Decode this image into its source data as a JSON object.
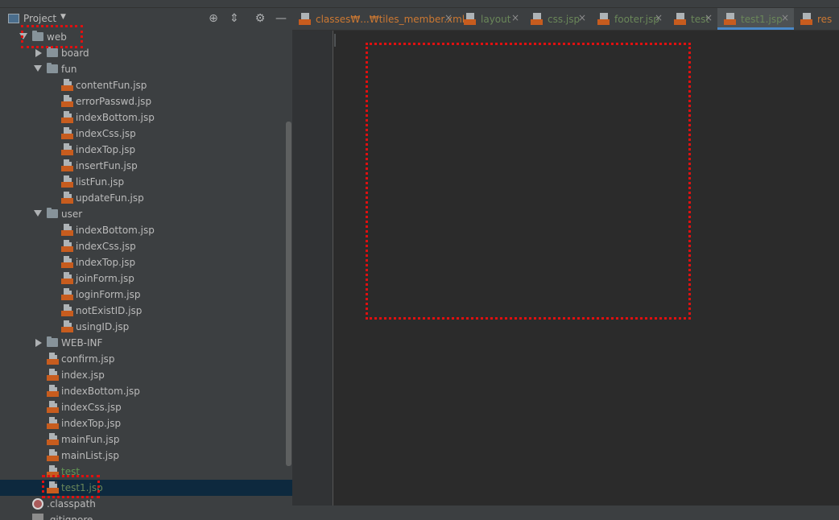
{
  "project_header": {
    "label": "Project",
    "caret": "▼",
    "locate_icon": "⊕",
    "collapse_icon": "⇕",
    "settings_icon": "⚙",
    "hide_icon": "—"
  },
  "tree": [
    {
      "label": "web",
      "kind": "folder",
      "expanded": true,
      "depth": 0
    },
    {
      "label": "board",
      "kind": "folder",
      "expanded": false,
      "depth": 1
    },
    {
      "label": "fun",
      "kind": "folder",
      "expanded": true,
      "depth": 1
    },
    {
      "label": "contentFun.jsp",
      "kind": "jsp",
      "depth": 2
    },
    {
      "label": "errorPasswd.jsp",
      "kind": "jsp",
      "depth": 2
    },
    {
      "label": "indexBottom.jsp",
      "kind": "jsp",
      "depth": 2
    },
    {
      "label": "indexCss.jsp",
      "kind": "jsp",
      "depth": 2
    },
    {
      "label": "indexTop.jsp",
      "kind": "jsp",
      "depth": 2
    },
    {
      "label": "insertFun.jsp",
      "kind": "jsp",
      "depth": 2
    },
    {
      "label": "listFun.jsp",
      "kind": "jsp",
      "depth": 2
    },
    {
      "label": "updateFun.jsp",
      "kind": "jsp",
      "depth": 2
    },
    {
      "label": "user",
      "kind": "folder",
      "expanded": true,
      "depth": 1
    },
    {
      "label": "indexBottom.jsp",
      "kind": "jsp",
      "depth": 2
    },
    {
      "label": "indexCss.jsp",
      "kind": "jsp",
      "depth": 2
    },
    {
      "label": "indexTop.jsp",
      "kind": "jsp",
      "depth": 2
    },
    {
      "label": "joinForm.jsp",
      "kind": "jsp",
      "depth": 2
    },
    {
      "label": "loginForm.jsp",
      "kind": "jsp",
      "depth": 2
    },
    {
      "label": "notExistID.jsp",
      "kind": "jsp",
      "depth": 2
    },
    {
      "label": "usingID.jsp",
      "kind": "jsp",
      "depth": 2
    },
    {
      "label": "WEB-INF",
      "kind": "folder",
      "expanded": false,
      "depth": 1
    },
    {
      "label": "confirm.jsp",
      "kind": "jsp",
      "depth": 1
    },
    {
      "label": "index.jsp",
      "kind": "jsp",
      "depth": 1
    },
    {
      "label": "indexBottom.jsp",
      "kind": "jsp",
      "depth": 1
    },
    {
      "label": "indexCss.jsp",
      "kind": "jsp",
      "depth": 1
    },
    {
      "label": "indexTop.jsp",
      "kind": "jsp",
      "depth": 1
    },
    {
      "label": "mainFun.jsp",
      "kind": "jsp",
      "depth": 1
    },
    {
      "label": "mainList.jsp",
      "kind": "jsp",
      "depth": 1
    },
    {
      "label": "test",
      "kind": "jsp",
      "depth": 1,
      "color": "test"
    },
    {
      "label": "test1.jsp",
      "kind": "jsp",
      "depth": 1,
      "color": "green",
      "selected": true
    },
    {
      "label": ".classpath",
      "kind": "circle",
      "depth": 0
    },
    {
      "label": ".gitignore",
      "kind": "git",
      "depth": 0
    }
  ],
  "tabs": [
    {
      "label": "classes₩...₩tiles_member.xml",
      "color": "#cc7832",
      "active": false
    },
    {
      "label": "layout",
      "color": "#6a8759",
      "active": false
    },
    {
      "label": "css.jsp",
      "color": "#6a8759",
      "active": false
    },
    {
      "label": "footer.jsp",
      "color": "#6a8759",
      "active": false
    },
    {
      "label": "test",
      "color": "#6a8759",
      "active": false
    },
    {
      "label": "test1.jsp",
      "color": "#6a8759",
      "active": true
    },
    {
      "label": "res",
      "color": "#cc7832",
      "active": false
    }
  ],
  "close_glyph": "×",
  "colors": {
    "annotation": "#e01010",
    "active_tab_underline": "#4a88c7"
  }
}
